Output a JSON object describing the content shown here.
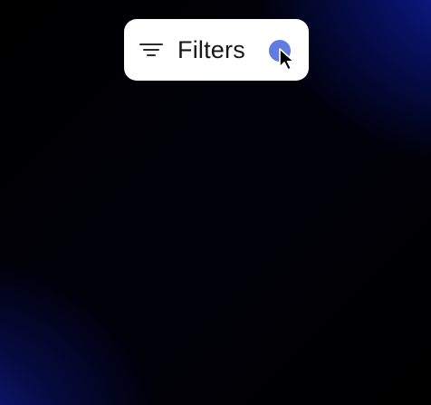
{
  "filters": {
    "label": "Filters",
    "icon": "filter-lines-icon"
  },
  "pointer": {
    "icon": "mouse-cursor-icon",
    "click_indicator_color": "#4664dc"
  },
  "colors": {
    "background": "#000000",
    "accent": "#1428be",
    "button_bg": "#ffffff",
    "text": "#16161c"
  }
}
